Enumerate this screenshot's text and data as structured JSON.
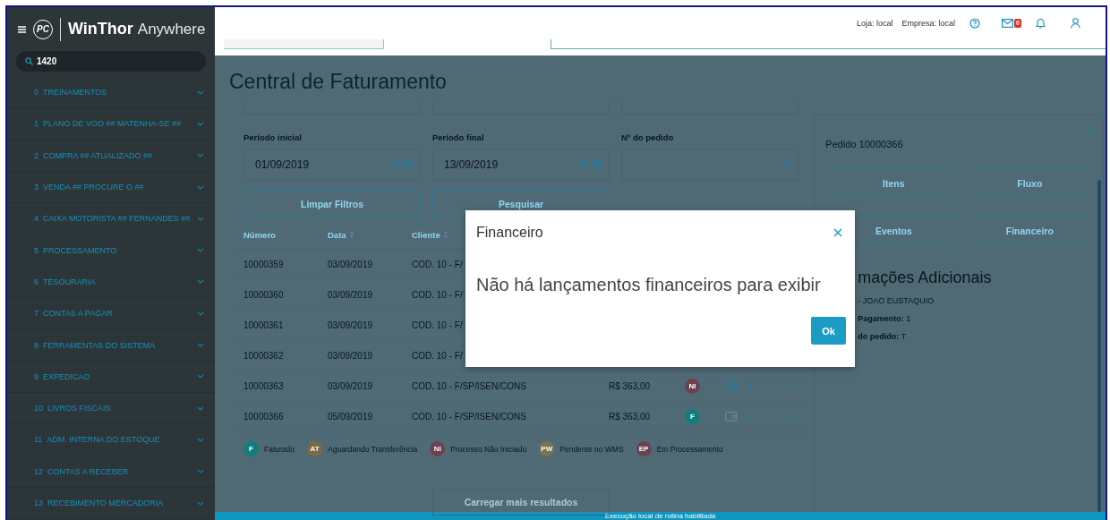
{
  "sidebar": {
    "logo": "PC",
    "brand": "WinThor",
    "brand_suffix": "Anywhere",
    "search": {
      "value": "1420"
    },
    "items": [
      {
        "number": "0",
        "label": "TREINAMENTOS",
        "expanded": false
      },
      {
        "number": "1",
        "label": "PLANO DE VOO ## MATENHA-SE ##",
        "expanded": false
      },
      {
        "number": "2",
        "label": "COMPRA ## ATUALIZADO ##",
        "expanded": false
      },
      {
        "number": "3",
        "label": "VENDA ## PROCURE O ##",
        "expanded": false
      },
      {
        "number": "4",
        "label": "CAIXA MOTORISTA ## FERNANDES ##",
        "expanded": false
      },
      {
        "number": "5",
        "label": "PROCESSAMENTO",
        "expanded": false
      },
      {
        "number": "6",
        "label": "TESOURARIA",
        "expanded": false
      },
      {
        "number": "7",
        "label": "CONTAS A PAGAR",
        "expanded": false
      },
      {
        "number": "8",
        "label": "FERRAMENTAS DO SISTEMA",
        "expanded": false
      },
      {
        "number": "9",
        "label": "EXPEDICAO",
        "expanded": false
      },
      {
        "number": "10",
        "label": "LIVROS FISCAIS",
        "expanded": false
      },
      {
        "number": "11",
        "label": "ADM. INTERNA DO ESTOQUE",
        "expanded": false
      },
      {
        "number": "12",
        "label": "CONTAS A RECEBER",
        "expanded": false
      },
      {
        "number": "13",
        "label": "RECEBIMENTO MERCADORIA",
        "expanded": false
      }
    ]
  },
  "header": {
    "store": "Loja: local",
    "company": "Empresa: local",
    "mail_count": "0"
  },
  "page": {
    "title": "Central de Faturamento",
    "filters": [
      {
        "label": "Período inicial",
        "value": "01/09/2019",
        "calendar": true
      },
      {
        "label": "Período final",
        "value": "13/09/2019",
        "calendar": true
      },
      {
        "label": "Nº do pedido",
        "calendar": false
      }
    ],
    "buttons": [
      "Limpar Filtros",
      "Pesquisar"
    ],
    "table": {
      "columns": [
        {
          "label": "Número",
          "sortable": false
        },
        {
          "label": "Data",
          "sortable": true
        },
        {
          "label": "Cliente",
          "sortable": true
        }
      ],
      "rows": [
        {
          "numero": "10000359",
          "data": "03/09/2019",
          "cliente": "COD. 10 - F/"
        },
        {
          "numero": "10000360",
          "data": "03/09/2019",
          "cliente": "COD. 10 - F/"
        },
        {
          "numero": "10000361",
          "data": "03/09/2019",
          "cliente": "COD. 10 - F/"
        },
        {
          "numero": "10000362",
          "data": "03/09/2019",
          "cliente": "COD. 10 - F/"
        },
        {
          "numero": "10000363",
          "data": "03/09/2019",
          "cliente": "COD. 10 - F/SP/ISEN/CONS",
          "valor": "R$ 363,00",
          "status": {
            "label": "NI",
            "color": "#6b4252"
          },
          "document_available": true
        },
        {
          "numero": "10000366",
          "data": "05/09/2019",
          "cliente": "COD. 10 - F/SP/ISEN/CONS",
          "valor": "R$ 363,00",
          "status": {
            "label": "F",
            "color": "#0f7e80"
          },
          "document_available": false
        }
      ]
    },
    "legend": [
      {
        "badge": "F",
        "label": "Faturado",
        "color": "#0f7e80"
      },
      {
        "badge": "AT",
        "label": "Aguardando Transferência",
        "color": "#7a6a48"
      },
      {
        "badge": "NI",
        "label": "Processo Não Iniciado",
        "color": "#6b4252"
      },
      {
        "badge": "PW",
        "label": "Pendente no WMS",
        "color": "#7a7250"
      },
      {
        "badge": "EP",
        "label": "Em Processamento",
        "color": "#6b4252"
      }
    ],
    "load_more": "Carregar mais resultados"
  },
  "detail": {
    "title": "Pedido 10000366",
    "buttons": [
      "Itens",
      "Fluxo",
      "Eventos",
      "Financeiro"
    ],
    "heading": "mações Adicionais",
    "lines": [
      "- JOAO EUSTAQUIO",
      "**Pagamento:** 1",
      "**do pedido:** T"
    ]
  },
  "dialog": {
    "title": "Financeiro",
    "message": "Não há lançamentos financeiros para exibir",
    "ok": "Ok"
  },
  "status_bar": "Execução local de rotina habilitada"
}
